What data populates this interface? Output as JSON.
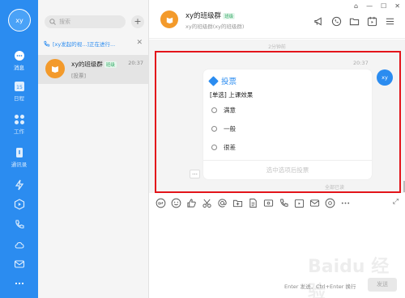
{
  "rail": {
    "avatar": "xy",
    "items": [
      {
        "label": "消息",
        "icon": "chat-icon"
      },
      {
        "label": "日程",
        "icon": "calendar-icon",
        "badge": "15"
      },
      {
        "label": "工作",
        "icon": "apps-icon"
      },
      {
        "label": "通讯录",
        "icon": "contacts-icon"
      },
      {
        "label": "",
        "icon": "lightning-icon"
      },
      {
        "label": "",
        "icon": "play-icon"
      },
      {
        "label": "",
        "icon": "phone-icon"
      },
      {
        "label": "",
        "icon": "cloud-icon"
      },
      {
        "label": "",
        "icon": "mail-icon"
      },
      {
        "label": "",
        "icon": "more-icon"
      }
    ],
    "accent": "#2b8cf0"
  },
  "list": {
    "search_placeholder": "搜索",
    "add_label": "+",
    "banner": "[xy发起的视...]正在进行...",
    "conversation": {
      "name": "xy的班级群",
      "tag": "班级",
      "time": "20:37",
      "preview": "[投票]"
    }
  },
  "chat": {
    "title": "xy的班级群",
    "tag": "班级",
    "subtitle": "xy的班级群(xy的班级群)",
    "time_separator": "2分钟前",
    "message_time": "20:37",
    "sender_avatar": "xy",
    "vote": {
      "title": "投票",
      "question": "[单选] 上课效果",
      "options": [
        "满意",
        "一般",
        "很差"
      ],
      "submit_label": "选中选项后投票"
    },
    "read_status": "全部已读",
    "send_hint": "Enter 发送，Ctrl+Enter 换行",
    "send_label": "发送",
    "highlight_color": "#e3141a"
  },
  "watermark": "Baidu 经验"
}
